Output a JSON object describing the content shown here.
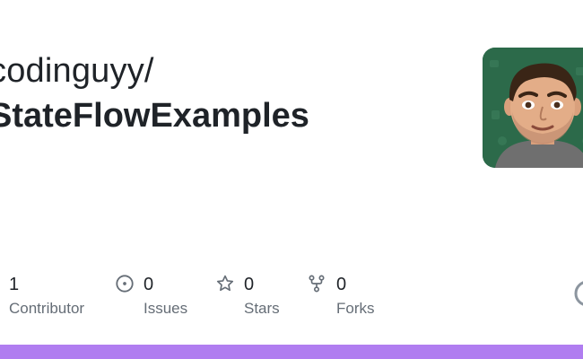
{
  "repo": {
    "owner": "codinguyy/",
    "name": "StateFlowExamples"
  },
  "stats": {
    "contributors": {
      "value": "1",
      "label": "Contributor",
      "icon": "people-icon"
    },
    "issues": {
      "value": "0",
      "label": "Issues",
      "icon": "issue-opened-icon"
    },
    "stars": {
      "value": "0",
      "label": "Stars",
      "icon": "star-icon"
    },
    "forks": {
      "value": "0",
      "label": "Forks",
      "icon": "repo-forked-icon"
    }
  },
  "colors": {
    "language_bar": "#b07df0",
    "text_primary": "#1f2328",
    "text_secondary": "#656d76",
    "avatar_bg": "#2c6a4a"
  }
}
